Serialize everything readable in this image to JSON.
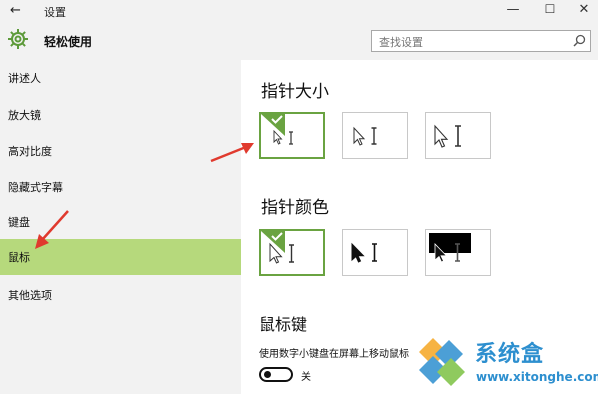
{
  "window": {
    "back_glyph": "←",
    "title": "设置",
    "min_glyph": "—",
    "max_glyph": "☐",
    "close_glyph": "✕"
  },
  "header": {
    "icon": "gear-icon",
    "title": "轻松使用",
    "search": {
      "placeholder": "查找设置",
      "icon": "search-icon"
    }
  },
  "sidebar": {
    "items": [
      {
        "label": "讲述人"
      },
      {
        "label": "放大镜"
      },
      {
        "label": "高对比度"
      },
      {
        "label": "隐藏式字幕"
      },
      {
        "label": "键盘"
      },
      {
        "label": "鼠标",
        "selected": true
      },
      {
        "label": "其他选项"
      }
    ],
    "selected_color": "#b6d97c"
  },
  "main": {
    "pointer_size": {
      "title": "指针大小",
      "options": [
        {
          "size": "small",
          "selected": true
        },
        {
          "size": "medium",
          "selected": false
        },
        {
          "size": "large",
          "selected": false
        }
      ]
    },
    "pointer_color": {
      "title": "指针颜色",
      "options": [
        {
          "scheme": "white",
          "selected": true
        },
        {
          "scheme": "black",
          "selected": false
        },
        {
          "scheme": "inverted",
          "selected": false
        }
      ]
    },
    "mouse_keys": {
      "title": "鼠标键",
      "description": "使用数字小键盘在屏幕上移动鼠标",
      "toggle_state": "off",
      "toggle_label": "关"
    },
    "accent_color": "#6aa341"
  },
  "watermark": {
    "name": "系统盒",
    "url": "www.xitonghe.com",
    "color": "#2d8fcf"
  }
}
